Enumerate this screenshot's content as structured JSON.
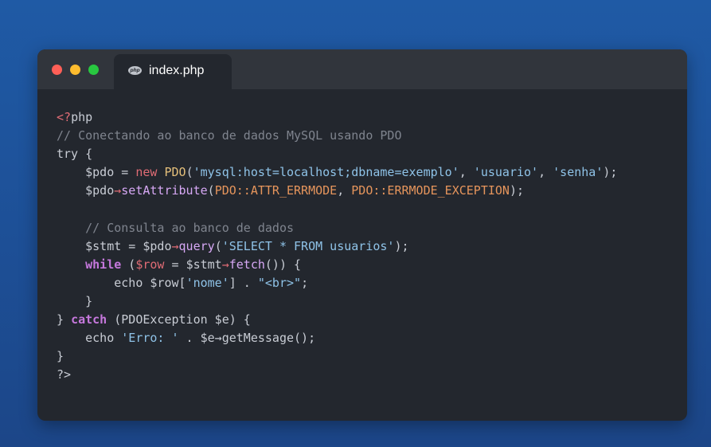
{
  "window": {
    "controls": {
      "close": "close-button",
      "minimize": "minimize-button",
      "maximize": "maximize-button"
    },
    "tab": {
      "icon": "php-icon",
      "icon_text": "php",
      "label": "index.php"
    }
  },
  "code": {
    "language": "php",
    "lines": [
      [
        [
          "tag",
          "<?"
        ],
        [
          "plain",
          "php"
        ]
      ],
      [
        [
          "comment",
          "// Conectando ao banco de dados MySQL usando PDO"
        ]
      ],
      [
        [
          "plain",
          "try {"
        ]
      ],
      [
        [
          "plain",
          "    "
        ],
        [
          "var",
          "$pdo"
        ],
        [
          "plain",
          " = "
        ],
        [
          "op",
          "new"
        ],
        [
          "plain",
          " "
        ],
        [
          "class",
          "PDO"
        ],
        [
          "punc",
          "("
        ],
        [
          "str",
          "'mysql:host=localhost;dbname=exemplo'"
        ],
        [
          "punc",
          ", "
        ],
        [
          "str",
          "'usuario'"
        ],
        [
          "punc",
          ", "
        ],
        [
          "str",
          "'senha'"
        ],
        [
          "punc",
          ");"
        ]
      ],
      [
        [
          "plain",
          "    "
        ],
        [
          "var",
          "$pdo"
        ],
        [
          "op",
          "→"
        ],
        [
          "fnv",
          "setAttribute"
        ],
        [
          "punc",
          "("
        ],
        [
          "const",
          "PDO::ATTR_ERRMODE"
        ],
        [
          "punc",
          ", "
        ],
        [
          "const",
          "PDO::ERRMODE_EXCEPTION"
        ],
        [
          "punc",
          ");"
        ]
      ],
      [],
      [
        [
          "plain",
          "    "
        ],
        [
          "comment",
          "// Consulta ao banco de dados"
        ]
      ],
      [
        [
          "plain",
          "    "
        ],
        [
          "var",
          "$stmt"
        ],
        [
          "plain",
          " = "
        ],
        [
          "var",
          "$pdo"
        ],
        [
          "op",
          "→"
        ],
        [
          "fnv",
          "query"
        ],
        [
          "punc",
          "("
        ],
        [
          "str",
          "'SELECT * FROM usuarios'"
        ],
        [
          "punc",
          ");"
        ]
      ],
      [
        [
          "plain",
          "    "
        ],
        [
          "kwh",
          "while"
        ],
        [
          "plain",
          " ("
        ],
        [
          "varred",
          "$row"
        ],
        [
          "plain",
          " = "
        ],
        [
          "var",
          "$stmt"
        ],
        [
          "op",
          "→"
        ],
        [
          "fnv",
          "fetch"
        ],
        [
          "punc",
          "()) {"
        ]
      ],
      [
        [
          "plain",
          "        echo $row["
        ],
        [
          "str",
          "'nome'"
        ],
        [
          "plain",
          "] . "
        ],
        [
          "str",
          "\"<br>\""
        ],
        [
          "punc",
          ";"
        ]
      ],
      [
        [
          "plain",
          "    }"
        ]
      ],
      [
        [
          "plain",
          "} "
        ],
        [
          "kwh",
          "catch"
        ],
        [
          "plain",
          " (PDOException $e) {"
        ]
      ],
      [
        [
          "plain",
          "    echo "
        ],
        [
          "str",
          "'Erro: '"
        ],
        [
          "plain",
          " . $e→getMessage();"
        ]
      ],
      [
        [
          "plain",
          "}"
        ]
      ],
      [
        [
          "plain",
          "?>"
        ]
      ]
    ]
  },
  "colors": {
    "background": "#1f5aa5",
    "window": "#23272e",
    "titlebar": "#31353c",
    "tag": "#e06c75",
    "comment": "#7f848e",
    "keyword": "#c678dd",
    "string": "#8fc3e8",
    "class": "#e5c07b",
    "constant": "#e6955c",
    "method": "#d7a8f5",
    "text": "#c8ccd4"
  }
}
